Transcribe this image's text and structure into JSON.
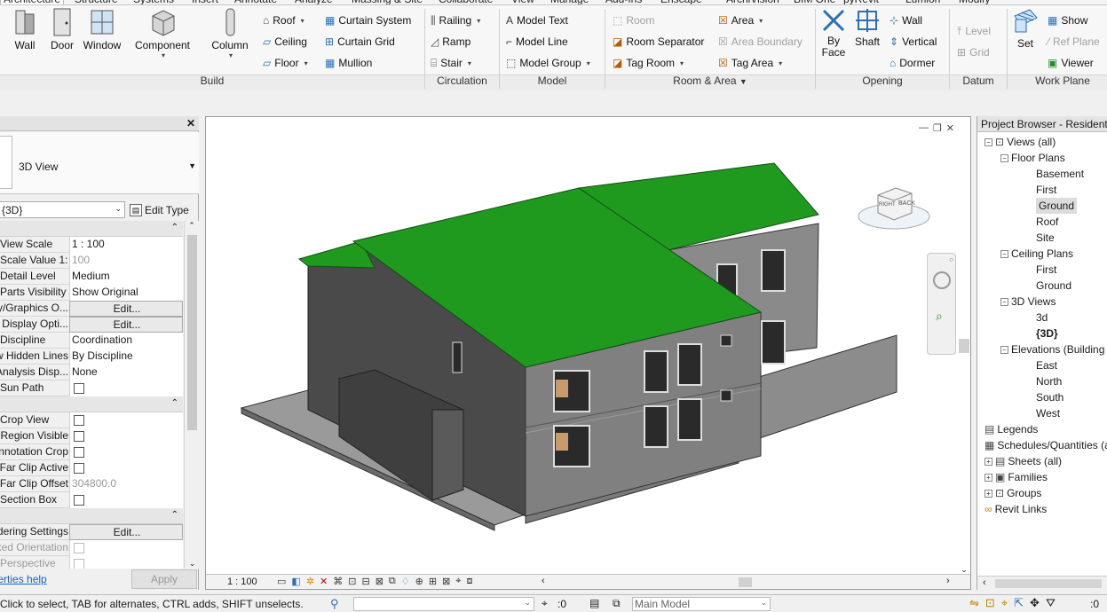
{
  "tabs": [
    "Architecture",
    "Structure",
    "Systems",
    "Insert",
    "Annotate",
    "Analyze",
    "Massing & Site",
    "Collaborate",
    "View",
    "Manage",
    "Add-Ins",
    "Enscape",
    "ArchiVision",
    "BIM One",
    "pyRevit",
    "Lumion",
    "Modify"
  ],
  "ribbon": {
    "build": {
      "label": "Build",
      "wall": "Wall",
      "door": "Door",
      "window": "Window",
      "component": "Component",
      "column": "Column",
      "roof": "Roof",
      "ceiling": "Ceiling",
      "floor": "Floor",
      "curtain_system": "Curtain System",
      "curtain_grid": "Curtain Grid",
      "mullion": "Mullion"
    },
    "circulation": {
      "label": "Circulation",
      "railing": "Railing",
      "ramp": "Ramp",
      "stair": "Stair"
    },
    "model": {
      "label": "Model",
      "model_text": "Model Text",
      "model_line": "Model Line",
      "model_group": "Model Group"
    },
    "room_area": {
      "label": "Room & Area",
      "room": "Room",
      "room_separator": "Room Separator",
      "tag_room": "Tag Room",
      "area": "Area",
      "area_boundary": "Area Boundary",
      "tag_area": "Tag Area"
    },
    "opening": {
      "label": "Opening",
      "by_face": "By Face",
      "by_face_1": "By",
      "by_face_2": "Face",
      "shaft": "Shaft",
      "wall": "Wall",
      "vertical": "Vertical",
      "dormer": "Dormer"
    },
    "datum": {
      "label": "Datum",
      "level": "Level",
      "grid": "Grid"
    },
    "work_plane": {
      "label": "Work Plane",
      "set": "Set",
      "show": "Show",
      "ref_plane": "Ref Plane",
      "viewer": "Viewer"
    }
  },
  "properties": {
    "close": "✕",
    "type_name": "3D View",
    "instance_selector": "{3D}",
    "edit_type": "Edit Type",
    "rows1": [
      {
        "key": "View Scale",
        "value": "1 : 100",
        "dim": false
      },
      {
        "key": "Scale Value 1:",
        "value": "100",
        "dim": true
      },
      {
        "key": "Detail Level",
        "value": "Medium",
        "dim": false
      },
      {
        "key": "Parts Visibility",
        "value": "Show Original",
        "dim": false
      },
      {
        "key": "Visibility/Graphics O...",
        "value": "Edit...",
        "btn": true
      },
      {
        "key": "Graphic Display Opti...",
        "value": "Edit...",
        "btn": true
      },
      {
        "key": "Discipline",
        "value": "Coordination",
        "dim": false
      },
      {
        "key": "Show Hidden Lines",
        "value": "By Discipline",
        "dim": false
      },
      {
        "key": "Default Analysis Disp...",
        "value": "None",
        "dim": false
      },
      {
        "key": "Sun Path",
        "value": "",
        "check": true
      }
    ],
    "rows2": [
      {
        "key": "Crop View",
        "value": "",
        "check": true
      },
      {
        "key": "Crop Region Visible",
        "value": "",
        "check": true
      },
      {
        "key": "Annotation Crop",
        "value": "",
        "check": true
      },
      {
        "key": "Far Clip Active",
        "value": "",
        "check": true
      },
      {
        "key": "Far Clip Offset",
        "value": "304800.0",
        "dim": true
      },
      {
        "key": "Section Box",
        "value": "",
        "check": true
      }
    ],
    "rows3": [
      {
        "key": "Rendering Settings",
        "value": "Edit...",
        "btn": true
      },
      {
        "key": "Locked Orientation",
        "value": "",
        "check": true,
        "dimcb": true,
        "dimkey": true
      },
      {
        "key": "Perspective",
        "value": "",
        "check": true,
        "dimcb": true,
        "dimkey": true
      }
    ],
    "help": "Properties help",
    "apply": "Apply"
  },
  "viewport": {
    "scale": "1 : 100",
    "viewcube_back": "BACK",
    "viewcube_right": "RIGHT"
  },
  "browser": {
    "title": "Project Browser - Residential",
    "items": [
      {
        "label": "Views (all)",
        "level": 0,
        "exp": "-",
        "icon": "views"
      },
      {
        "label": "Floor Plans",
        "level": 1,
        "exp": "-"
      },
      {
        "label": "Basement",
        "level": 2
      },
      {
        "label": "First",
        "level": 2
      },
      {
        "label": "Ground",
        "level": 2,
        "sel": true
      },
      {
        "label": "Roof",
        "level": 2
      },
      {
        "label": "Site",
        "level": 2
      },
      {
        "label": "Ceiling Plans",
        "level": 1,
        "exp": "-"
      },
      {
        "label": "First",
        "level": 2
      },
      {
        "label": "Ground",
        "level": 2
      },
      {
        "label": "3D Views",
        "level": 1,
        "exp": "-"
      },
      {
        "label": "3d",
        "level": 2
      },
      {
        "label": "{3D}",
        "level": 2,
        "bold": true
      },
      {
        "label": "Elevations (Building Elevation)",
        "level": 1,
        "exp": "-"
      },
      {
        "label": "East",
        "level": 2
      },
      {
        "label": "North",
        "level": 2
      },
      {
        "label": "South",
        "level": 2
      },
      {
        "label": "West",
        "level": 2
      },
      {
        "label": "Legends",
        "level": 0,
        "icon": "legend"
      },
      {
        "label": "Schedules/Quantities (all)",
        "level": 0,
        "icon": "schedule"
      },
      {
        "label": "Sheets (all)",
        "level": 0,
        "exp": "+",
        "icon": "sheet"
      },
      {
        "label": "Families",
        "level": 0,
        "exp": "+",
        "icon": "family"
      },
      {
        "label": "Groups",
        "level": 0,
        "exp": "+",
        "icon": "group"
      },
      {
        "label": "Revit Links",
        "level": 0,
        "icon": "link"
      }
    ]
  },
  "status": {
    "message": "Click to select, TAB for alternates, CTRL adds, SHIFT unselects.",
    "zero": ":0",
    "model": "Main Model"
  },
  "colors": {
    "roof": "#1f9a1f",
    "wall_dark": "#4a4a4a",
    "wall_mid": "#808080",
    "accent": "#1565c0"
  }
}
